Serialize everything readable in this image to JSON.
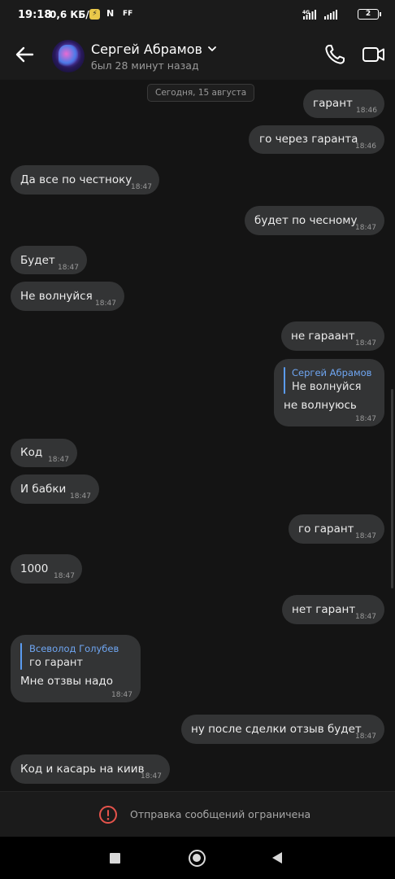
{
  "status_bar": {
    "time": "19:18",
    "speed": "0,6 КБ/с",
    "notif_n": "N",
    "notif_ff": "FF",
    "signal": "4G",
    "battery": "2"
  },
  "header": {
    "contact_name": "Сергей Абрамов",
    "contact_status": "был 28 минут назад"
  },
  "chat": {
    "date_separator": "Сегодня, 15 августа",
    "messages": [
      {
        "direction": "out",
        "text": "гарант",
        "time": "18:46"
      },
      {
        "direction": "out",
        "text": "го через гаранта",
        "time": "18:46"
      },
      {
        "direction": "in",
        "text": "Да все по честноку",
        "time": "18:47"
      },
      {
        "direction": "out",
        "text": "будет по чесному",
        "time": "18:47"
      },
      {
        "direction": "in",
        "text": "Будет",
        "time": "18:47"
      },
      {
        "direction": "in",
        "text": "Не волнуйся",
        "time": "18:47"
      },
      {
        "direction": "out",
        "text": "не гараант",
        "time": "18:47"
      },
      {
        "direction": "out",
        "reply_to_name": "Сергей Абрамов",
        "reply_to_text": "Не волнуйся",
        "text": "не волнуюсь",
        "time": "18:47"
      },
      {
        "direction": "in",
        "text": "Код",
        "time": "18:47"
      },
      {
        "direction": "in",
        "text": "И бабки",
        "time": "18:47"
      },
      {
        "direction": "out",
        "text": "го гарант",
        "time": "18:47"
      },
      {
        "direction": "in",
        "text": "1000",
        "time": "18:47"
      },
      {
        "direction": "out",
        "text": "нет гарант",
        "time": "18:47"
      },
      {
        "direction": "in",
        "reply_to_name": "Всеволод Голубев",
        "reply_to_text": "го гарант",
        "text": "Мне отзвы надо",
        "time": "18:47"
      },
      {
        "direction": "out",
        "text": "ну после сделки отзыв будет",
        "time": "18:47"
      },
      {
        "direction": "in",
        "text": "Код и касарь на киив",
        "time": "18:47"
      }
    ]
  },
  "restricted_bar": {
    "text": "Отправка сообщений ограничена",
    "icon": "warning-icon",
    "icon_color": "#e5534b"
  },
  "colors": {
    "bubble": "#333435",
    "background": "#141414",
    "reply_accent": "#5b9bf0"
  }
}
